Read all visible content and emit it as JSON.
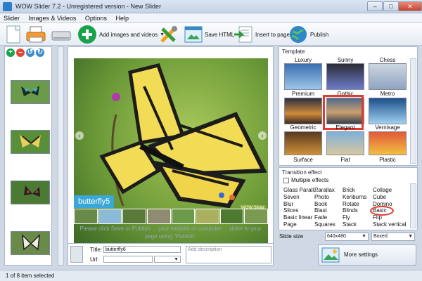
{
  "window": {
    "title": "WOW Slider 7.2 - Unregistered version - New Slider",
    "minimize": "–",
    "maximize": "□",
    "close": "✕"
  },
  "menu": [
    "Slider",
    "Images & Videos",
    "Options",
    "Help"
  ],
  "toolbar": {
    "add_images": "Add images and videos",
    "save_html": "Save HTML",
    "insert_to_page": "Insert to page",
    "publish": "Publish"
  },
  "left_panel": {
    "icons": [
      "add-icon",
      "remove-icon",
      "rotate-left-icon",
      "rotate-right-icon"
    ]
  },
  "preview": {
    "caption": "butterfly5",
    "watermark": "WOW Slider",
    "hint_line1": "Please click Save or Publish ... your website or computer ... slider to your",
    "hint_line2": "page using",
    "hint_publish": "\"Publish\""
  },
  "properties": {
    "title_label": "Title:",
    "title_value": "butterfly6",
    "url_label": "Url:",
    "url_value": "",
    "description_placeholder": "Add description"
  },
  "template": {
    "group_label": "Template",
    "names_row0": [
      "Luxury",
      "Sunny",
      "Chess"
    ],
    "names_row1": [
      "Premium",
      "Gothic",
      "Metro"
    ],
    "names_row2": [
      "Geometric",
      "Elegant",
      "Vernisage"
    ],
    "names_row3": [
      "Surface",
      "Flat",
      "Plastic"
    ],
    "selected": "Elegant"
  },
  "transition": {
    "group_label": "Transition effect",
    "multiple_label": "Multiple effects",
    "col1": [
      "Glass Parall...",
      "Seven",
      "Blur",
      "Slices",
      "Basic linear",
      "Page"
    ],
    "col2": [
      "Parallax",
      "Photo",
      "Book",
      "Blast",
      "Fade",
      "Squares"
    ],
    "col3": [
      "Brick",
      "Kenburns",
      "Rotate",
      "Blinds",
      "Fly",
      "Stack"
    ],
    "col4": [
      "Collage",
      "Cube",
      "Domino",
      "Basic",
      "Flip",
      "Stack vertical"
    ],
    "selected": "Basic"
  },
  "slide_size": {
    "label": "Slide size",
    "value": "640x480",
    "mode": "Boxed"
  },
  "more_settings": "More settings",
  "status": "1 of 8 item selected",
  "colors": {
    "accent": "#3aa7d8",
    "highlight": "#e03b2b",
    "add_green": "#18a34a"
  }
}
